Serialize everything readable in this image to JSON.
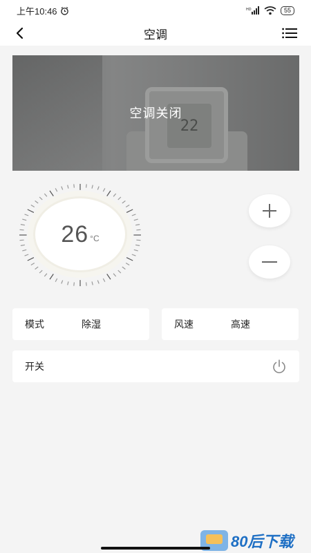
{
  "status_bar": {
    "time": "上午10:46",
    "battery": "55"
  },
  "header": {
    "title": "空调"
  },
  "banner": {
    "status_text": "空调关闭",
    "display_reading": "22"
  },
  "dial": {
    "temperature": "26",
    "unit": "°C"
  },
  "controls": {
    "mode_label": "模式",
    "mode_value": "除湿",
    "wind_label": "风速",
    "wind_value": "高速",
    "switch_label": "开关"
  },
  "icons": {
    "back": "chevron-left-icon",
    "menu": "list-icon",
    "plus": "plus-icon",
    "minus": "minus-icon",
    "power": "power-icon",
    "alarm": "alarm-clock-icon"
  },
  "colors": {
    "accent": "#f6f5ef",
    "watermark_blue": "#1e6fc4"
  },
  "watermark": {
    "text": "80后下载"
  }
}
